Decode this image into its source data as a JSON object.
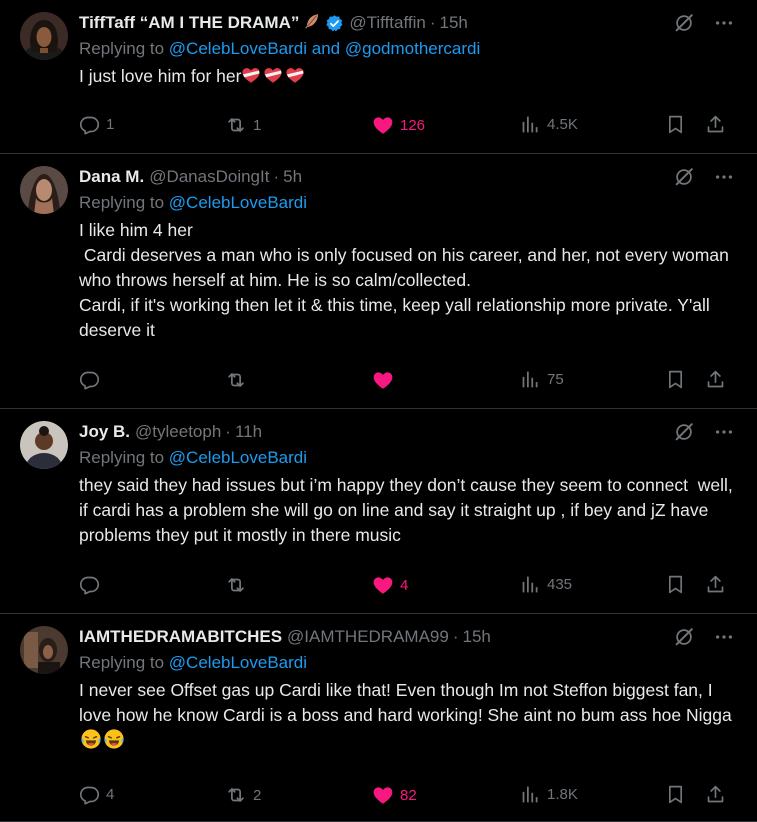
{
  "tweets": [
    {
      "name": "TiffTaff “AM I THE DRAMA”",
      "handle": "@Tifftaffin",
      "time": "15h",
      "replying_label": "Replying to",
      "mention1": "@CelebLoveBardi",
      "and": "and",
      "mention2": "@godmothercardi",
      "text": "I just love him for her",
      "replies": "1",
      "reposts": "1",
      "likes": "126",
      "views": "4.5K"
    },
    {
      "name": "Dana M.",
      "handle": "@DanasDoingIt",
      "time": "5h",
      "replying_label": "Replying to",
      "mention1": "@CelebLoveBardi",
      "text": "I like him 4 her\n Cardi deserves a man who is only focused on his career, and her, not every woman who throws herself at him. He is so calm/collected.\nCardi, if it's working then let it & this time, keep yall relationship more private. Y'all deserve it",
      "replies": "",
      "reposts": "",
      "likes": "",
      "views": "75"
    },
    {
      "name": "Joy B.",
      "handle": "@tyleetoph",
      "time": "11h",
      "replying_label": "Replying to",
      "mention1": "@CelebLoveBardi",
      "text": "they said they had issues but i’m happy they don’t cause they seem to connect  well, if cardi has a problem she will go on line and say it straight up , if bey and jZ have problems they put it mostly in there music",
      "replies": "",
      "reposts": "",
      "likes": "4",
      "views": "435"
    },
    {
      "name": "IAMTHEDRAMABITCHES",
      "handle": "@IAMTHEDRAMA99",
      "time": "15h",
      "replying_label": "Replying to",
      "mention1": "@CelebLoveBardi",
      "text": "I never see Offset gas up Cardi like that! Even though Im not Steffon biggest fan, I love how he know Cardi is a boss and hard working! She aint no bum ass hoe Nigga",
      "replies": "4",
      "reposts": "2",
      "likes": "82",
      "views": "1.8K"
    }
  ],
  "colors": {
    "background": "#000000",
    "text": "#e7e9ea",
    "muted": "#71767b",
    "link": "#1d9bf0",
    "like": "#f91880",
    "divider": "#2f3336",
    "verified": "#1d9bf0"
  },
  "icons": [
    "grok-icon",
    "more-icon",
    "reply-icon",
    "repost-icon",
    "like-icon",
    "views-icon",
    "bookmark-icon",
    "share-icon",
    "verified-icon",
    "feather-icon",
    "heart-ribbon-emoji",
    "laughing-tears-emoji"
  ]
}
